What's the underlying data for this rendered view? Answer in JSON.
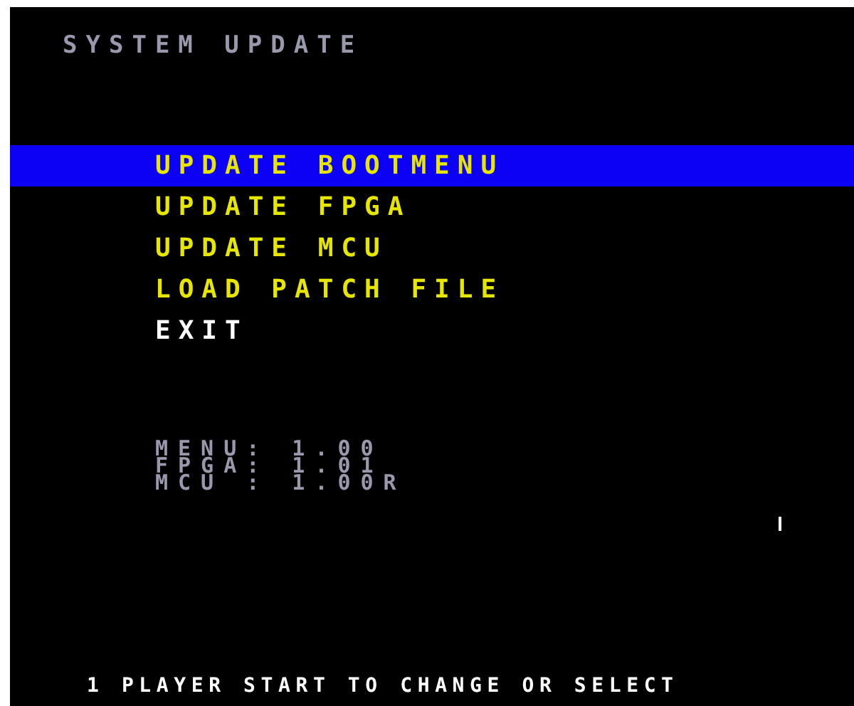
{
  "title": "SYSTEM UPDATE",
  "menu": [
    {
      "label": "UPDATE BOOTMENU",
      "kind": "action",
      "selected": true
    },
    {
      "label": "UPDATE FPGA",
      "kind": "action",
      "selected": false
    },
    {
      "label": "UPDATE MCU",
      "kind": "action",
      "selected": false
    },
    {
      "label": "LOAD PATCH FILE",
      "kind": "action",
      "selected": false
    },
    {
      "label": "EXIT",
      "kind": "exit",
      "selected": false
    }
  ],
  "versions": [
    {
      "label": "MENU:",
      "value": "1.00"
    },
    {
      "label": "FPGA:",
      "value": "1.01"
    },
    {
      "label": "MCU :",
      "value": "1.00R"
    }
  ],
  "footer": "1 PLAYER START TO CHANGE OR SELECT"
}
